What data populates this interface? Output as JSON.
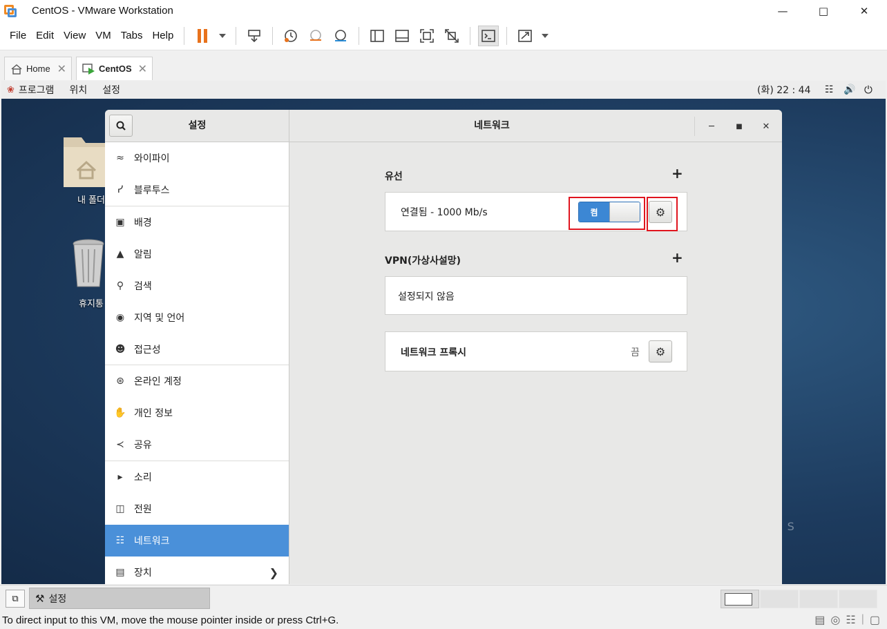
{
  "window": {
    "title": "CentOS - VMware Workstation"
  },
  "menubar": {
    "items": [
      "File",
      "Edit",
      "View",
      "VM",
      "Tabs",
      "Help"
    ]
  },
  "tabs": [
    {
      "label": "Home"
    },
    {
      "label": "CentOS"
    }
  ],
  "guest": {
    "topbar": {
      "menus": [
        "프로그램",
        "위치",
        "설정"
      ],
      "clock": "(화) 22 : 44"
    },
    "desktop": {
      "folder_label": "내 폴더",
      "trash_label": "휴지통",
      "watermark": "O S"
    },
    "taskbar": {
      "item_label": "설정"
    }
  },
  "settings": {
    "sidebar_title": "설정",
    "page_title": "네트워크",
    "sidebar": [
      {
        "label": "와이파이",
        "icon": "wifi-icon"
      },
      {
        "label": "블루투스",
        "icon": "bluetooth-icon"
      },
      {
        "label": "배경",
        "icon": "background-icon"
      },
      {
        "label": "알림",
        "icon": "bell-icon"
      },
      {
        "label": "검색",
        "icon": "search-icon"
      },
      {
        "label": "지역 및 언어",
        "icon": "region-icon"
      },
      {
        "label": "접근성",
        "icon": "accessibility-icon"
      },
      {
        "label": "온라인 계정",
        "icon": "online-accounts-icon"
      },
      {
        "label": "개인 정보",
        "icon": "privacy-hand-icon"
      },
      {
        "label": "공유",
        "icon": "share-icon"
      },
      {
        "label": "소리",
        "icon": "speaker-icon"
      },
      {
        "label": "전원",
        "icon": "power-icon"
      },
      {
        "label": "네트워크",
        "icon": "network-icon"
      },
      {
        "label": "장치",
        "icon": "devices-icon"
      }
    ],
    "wired": {
      "title": "유선",
      "status": "연결됨 - 1000 Mb/s",
      "switch_label": "켬"
    },
    "vpn": {
      "title": "VPN(가상사설망)",
      "empty_text": "설정되지 않음"
    },
    "proxy": {
      "label": "네트워크 프록시",
      "value": "끔"
    }
  },
  "statusbar": {
    "text": "To direct input to this VM, move the mouse pointer inside or press Ctrl+G."
  },
  "colors": {
    "accent": "#4a90d9",
    "highlight": "#e0141e",
    "pause": "#e8721c"
  }
}
